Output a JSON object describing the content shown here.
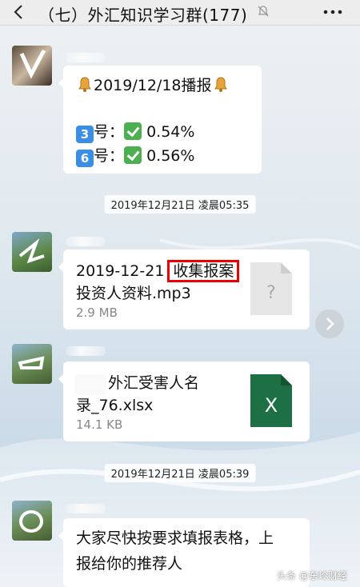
{
  "header": {
    "title": "（七）外汇知识学习群(177)"
  },
  "messages": [
    {
      "line1": "2019/12/18播报",
      "line2_key": "3",
      "line2_label": "号：",
      "line2_value": "0.54%",
      "line3_key": "6",
      "line3_label": "号：",
      "line3_value": "0.56%"
    },
    {
      "file_name_part1": "2019-12-21",
      "file_name_highlight": "收集报案",
      "file_name_part2": "投资人资料.mp3",
      "file_size": "2.9 MB",
      "icon_glyph": "?"
    },
    {
      "file_name_part1": "外汇受害人名",
      "file_name_part2": "录_76.xlsx",
      "file_size": "14.1 KB",
      "icon_glyph": "X"
    },
    {
      "line1": "大家尽快按要求填报表格，上",
      "line2": "报给你的推荐人"
    }
  ],
  "timestamps": [
    "2019年12月21日 凌晨05:35",
    "2019年12月21日 凌晨05:39"
  ],
  "watermark": "头条 @东岭财经",
  "colors": {
    "highlight": "#e00000",
    "excel": "#1d7044",
    "check": "#4caf50"
  }
}
